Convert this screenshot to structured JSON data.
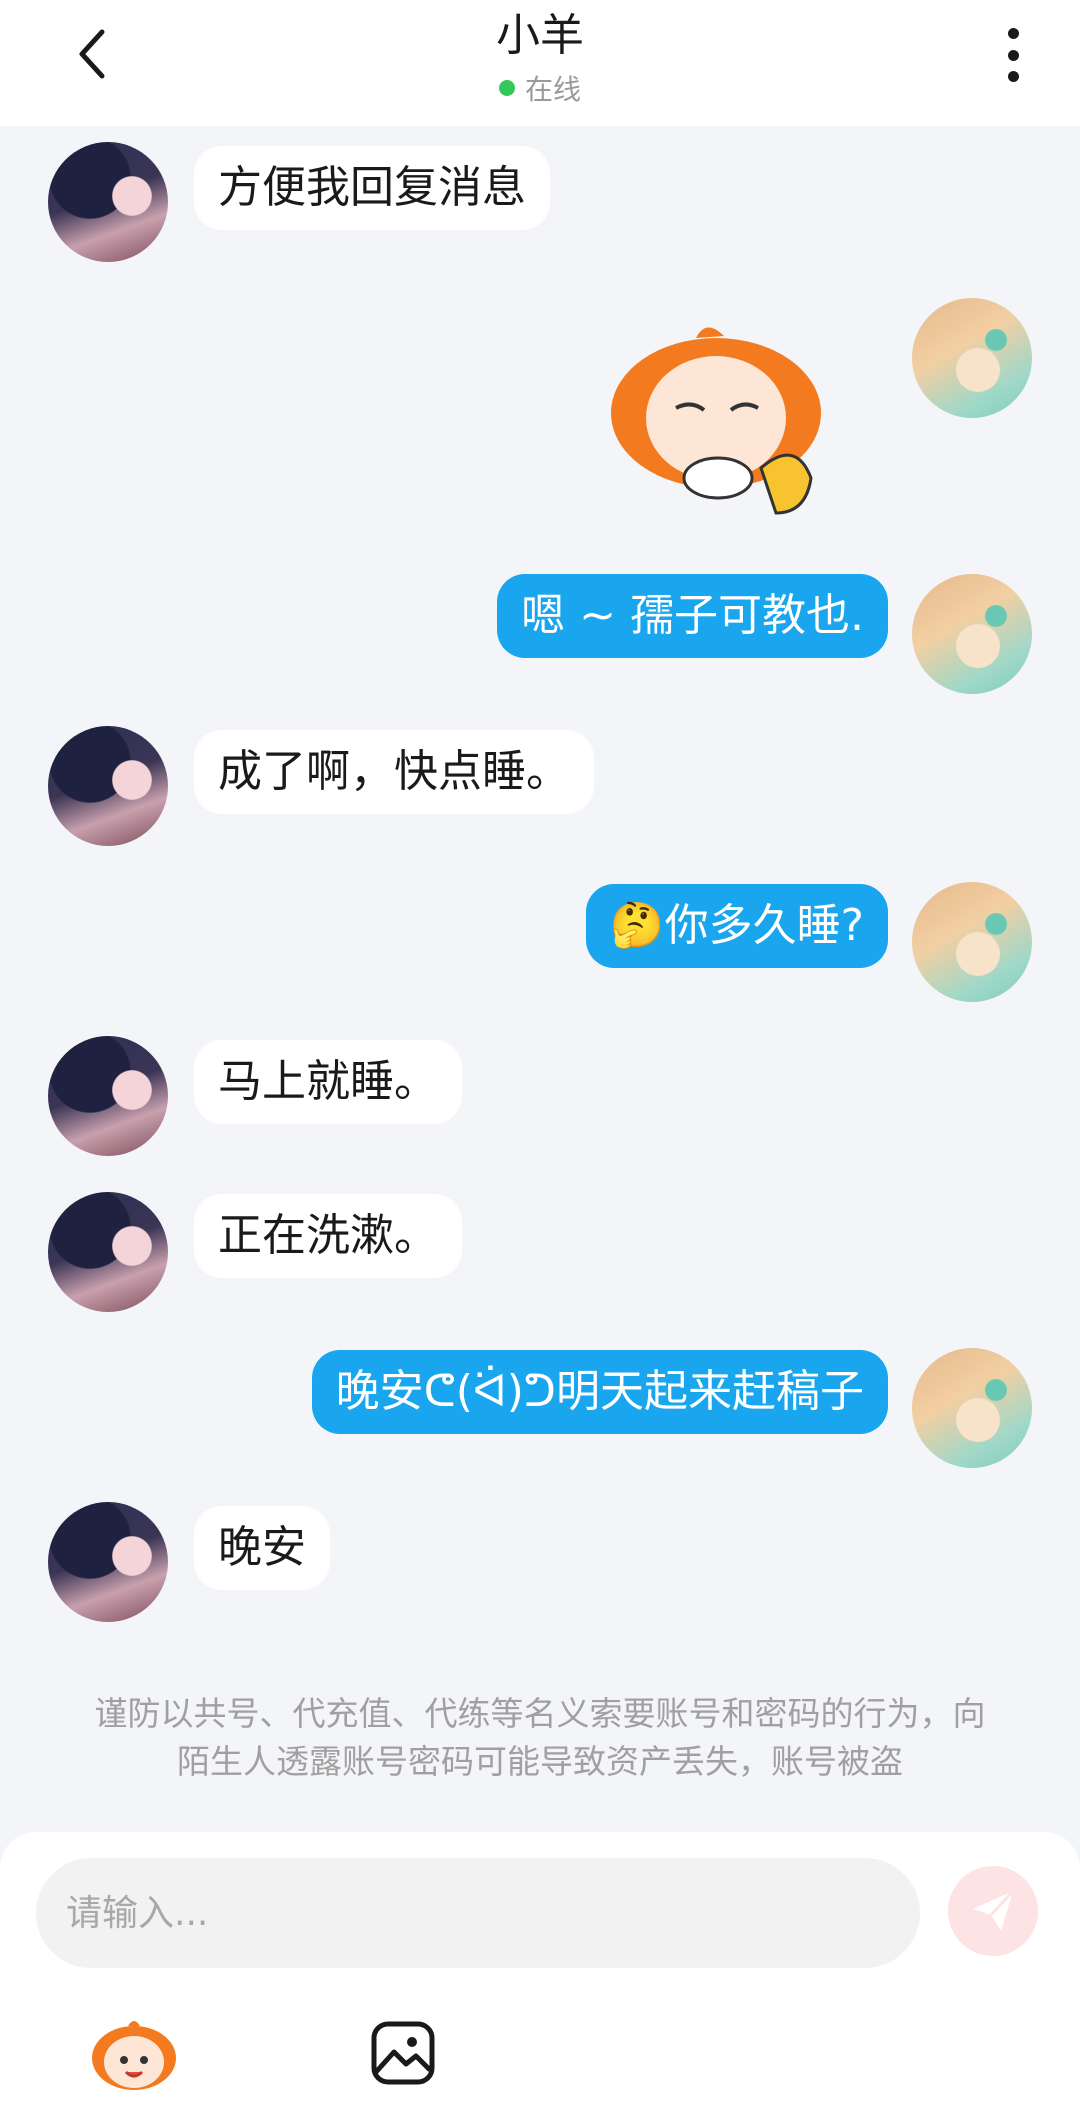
{
  "header": {
    "title": "小羊",
    "status": "在线",
    "status_color": "#34c759"
  },
  "messages": [
    {
      "side": "left",
      "type": "text",
      "text": "方便我回复消息"
    },
    {
      "side": "right",
      "type": "sticker",
      "sticker": "orange-character-drinking-tea-thumbs-up"
    },
    {
      "side": "right",
      "type": "text",
      "text": "嗯 ~ 孺子可教也."
    },
    {
      "side": "left",
      "type": "text",
      "text": "成了啊，快点睡。"
    },
    {
      "side": "right",
      "type": "text",
      "text": "🤔你多久睡?"
    },
    {
      "side": "left",
      "type": "text",
      "text": "马上就睡。"
    },
    {
      "side": "left",
      "type": "text",
      "text": "正在洗漱。"
    },
    {
      "side": "right",
      "type": "text",
      "text": "晚安ᕦ(ᐛ)ᕤ明天起来赶稿子"
    },
    {
      "side": "left",
      "type": "text",
      "text": "晚安"
    }
  ],
  "warning": "谨防以共号、代充值、代练等名义索要账号和密码的行为，向陌生人透露账号密码可能导致资产丢失，账号被盗",
  "input": {
    "placeholder": "请输入...",
    "value": ""
  },
  "colors": {
    "accent": "#1aa6ee",
    "send_disabled": "#fde3e3",
    "send_icon": "#ffffff"
  },
  "icons": {
    "back": "chevron-left-icon",
    "more": "more-vertical-icon",
    "send": "send-icon",
    "emoji": "emoji-sticker-icon",
    "image": "image-icon"
  }
}
